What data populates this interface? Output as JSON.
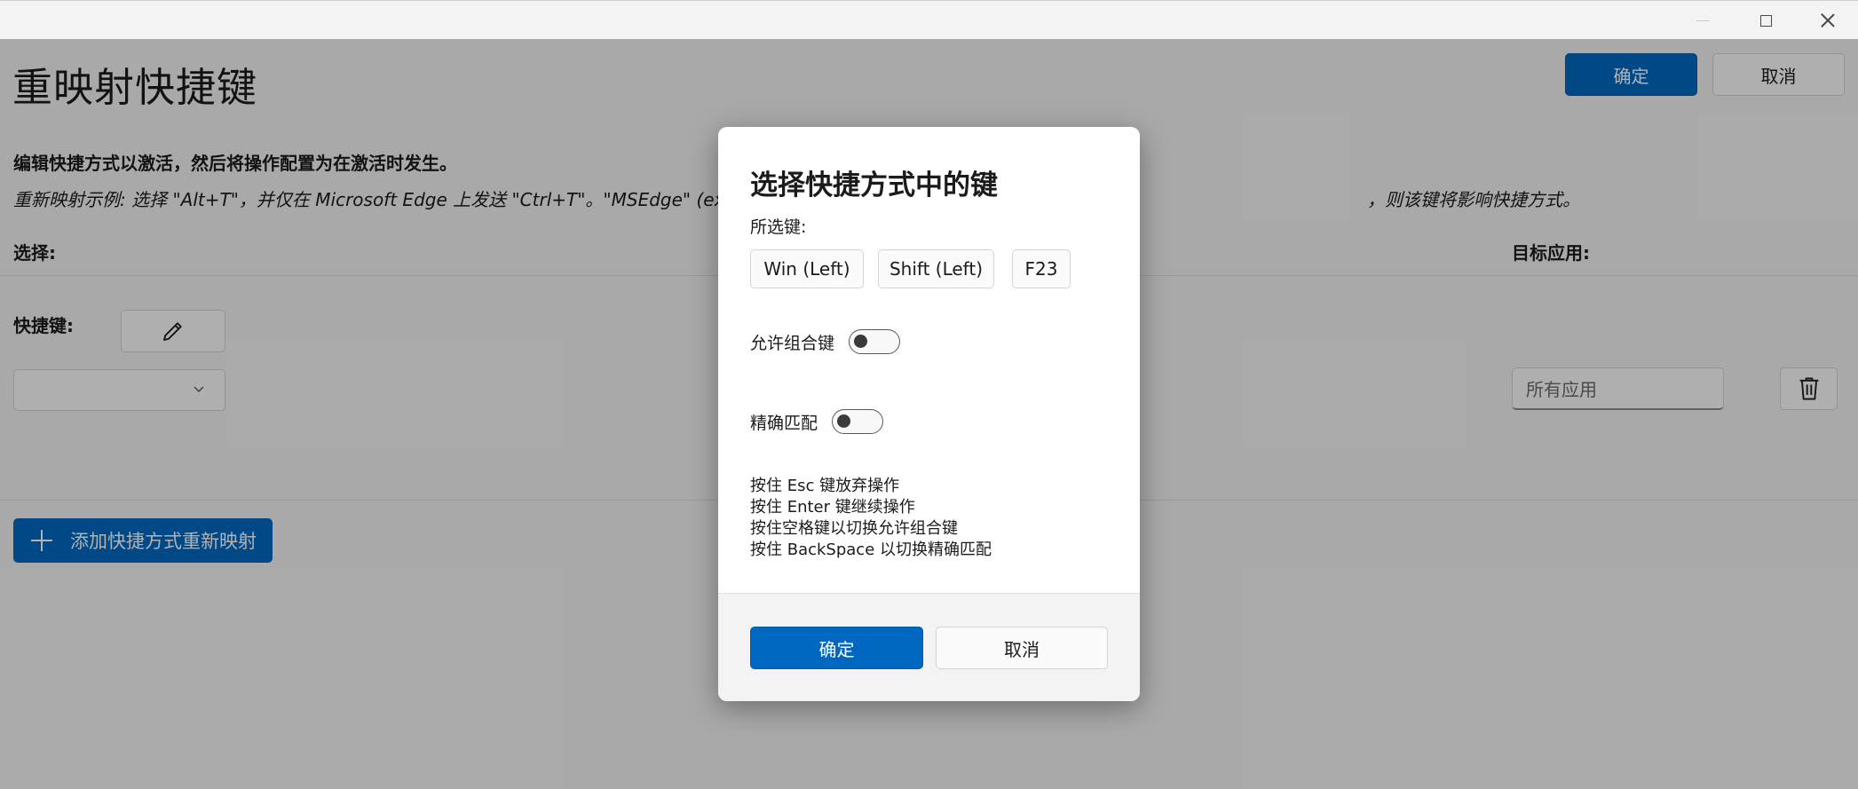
{
  "window": {
    "controls": [
      "minimize",
      "maximize",
      "close"
    ]
  },
  "page": {
    "title": "重映射快捷键",
    "ok_label": "确定",
    "cancel_label": "取消",
    "description": "编辑快捷方式以激活，然后将操作配置为在激活时发生。",
    "example_left": "重新映射示例: 选择 \"Alt+T\"，并仅在 Microsoft Edge 上发送 \"Ctrl+T\"。\"MSEdge\" (exe 名",
    "example_right": "，则该键将影响快捷方式。",
    "col_select": "选择:",
    "col_target": "目标应用:",
    "shortcut_label": "快捷键:",
    "target_app_placeholder": "所有应用",
    "add_button_label": "添加快捷方式重新映射"
  },
  "dialog": {
    "title": "选择快捷方式中的键",
    "selected_label": "所选键:",
    "keys": [
      "Win (Left)",
      "Shift (Left)",
      "F23"
    ],
    "allow_chords_label": "允许组合键",
    "allow_chords_on": false,
    "exact_match_label": "精确匹配",
    "exact_match_on": false,
    "hints": [
      "按住 Esc 键放弃操作",
      "按住 Enter 键继续操作",
      "按住空格键以切换允许组合键",
      "按住 BackSpace 以切换精确匹配"
    ],
    "ok_label": "确定",
    "cancel_label": "取消"
  },
  "colors": {
    "accent": "#0067c0",
    "background": "#f3f3f3",
    "overlay": "rgba(0,0,0,0.30)"
  },
  "icons": [
    "minimize-icon",
    "maximize-icon",
    "close-icon",
    "pencil-icon",
    "chevron-down-icon",
    "trash-icon",
    "plus-icon"
  ]
}
